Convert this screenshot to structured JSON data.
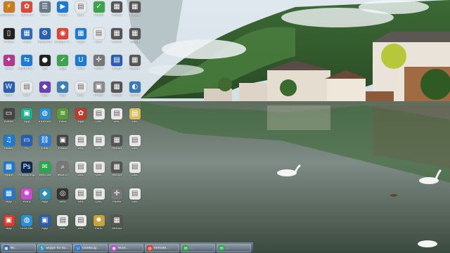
{
  "desktop_icons": [
    {
      "label": "Wondershare",
      "icon": "app-icon",
      "color": "#c97b1f",
      "glyph": "⚡"
    },
    {
      "label": "Tencent",
      "icon": "app-icon",
      "color": "#d94b37",
      "glyph": "✿"
    },
    {
      "label": "Wi-Fi",
      "icon": "app-icon",
      "color": "#6a7a8d",
      "glyph": "☰"
    },
    {
      "label": "Video",
      "icon": "play-icon",
      "color": "#1e7ad1",
      "glyph": "▶"
    },
    {
      "label": "Doc",
      "icon": "document-icon",
      "color": "#e8e8e8",
      "glyph": "▤"
    },
    {
      "label": "Cloud",
      "icon": "app-icon",
      "color": "#3fa34d",
      "glyph": "✓"
    },
    {
      "label": "Media",
      "icon": "app-icon",
      "color": "#555",
      "glyph": "▦"
    },
    {
      "label": "Media",
      "icon": "app-icon",
      "color": "#555",
      "glyph": "▦"
    },
    {
      "label": "Phone",
      "icon": "phone-icon",
      "color": "#222",
      "glyph": "▯"
    },
    {
      "label": "Tools",
      "icon": "app-icon",
      "color": "#2e6db4",
      "glyph": "▦"
    },
    {
      "label": "Network",
      "icon": "app-icon",
      "color": "#2a5fb0",
      "glyph": "⚙"
    },
    {
      "label": "Google Chrome",
      "icon": "chrome-icon",
      "color": "#db4437",
      "glyph": "◉"
    },
    {
      "label": "Apps",
      "icon": "app-icon",
      "color": "#1e7ad1",
      "glyph": "▦"
    },
    {
      "label": "Doc",
      "icon": "document-icon",
      "color": "#e8e8e8",
      "glyph": "▤"
    },
    {
      "label": "Media",
      "icon": "app-icon",
      "color": "#555",
      "glyph": "▦"
    },
    {
      "label": "Media",
      "icon": "app-icon",
      "color": "#555",
      "glyph": "▦"
    },
    {
      "label": "Tools",
      "icon": "app-icon",
      "color": "#b03a8c",
      "glyph": "✦"
    },
    {
      "label": "TeamViewer",
      "icon": "app-icon",
      "color": "#1e7ad1",
      "glyph": "⇆"
    },
    {
      "label": "QQ",
      "icon": "app-icon",
      "color": "#222",
      "glyph": "●"
    },
    {
      "label": "App",
      "icon": "app-icon",
      "color": "#3fa34d",
      "glyph": "✓"
    },
    {
      "label": "Link",
      "icon": "app-icon",
      "color": "#1e7ad1",
      "glyph": "U"
    },
    {
      "label": "Move",
      "icon": "app-icon",
      "color": "#777",
      "glyph": "✛"
    },
    {
      "label": "Sheet",
      "icon": "document-icon",
      "color": "#2a5fb0",
      "glyph": "▤"
    },
    {
      "label": "Media",
      "icon": "app-icon",
      "color": "#555",
      "glyph": "▦"
    },
    {
      "label": "Word",
      "icon": "word-icon",
      "color": "#2a5fb0",
      "glyph": "W"
    },
    {
      "label": "Doc",
      "icon": "document-icon",
      "color": "#e8e8e8",
      "glyph": "▤"
    },
    {
      "label": "App",
      "icon": "app-icon",
      "color": "#6a3fb0",
      "glyph": "◆"
    },
    {
      "label": "App",
      "icon": "app-icon",
      "color": "#3f7fb0",
      "glyph": "◆"
    },
    {
      "label": "Doc",
      "icon": "document-icon",
      "color": "#e8e8e8",
      "glyph": "▤"
    },
    {
      "label": "Photo",
      "icon": "photo-icon",
      "color": "#8a8a8a",
      "glyph": "▣"
    },
    {
      "label": "Media",
      "icon": "app-icon",
      "color": "#555",
      "glyph": "▦"
    },
    {
      "label": "Media",
      "icon": "app-icon",
      "color": "#3a7ab0",
      "glyph": "◐"
    },
    {
      "label": "Folder",
      "icon": "app-icon",
      "color": "#444",
      "glyph": "▭"
    },
    {
      "label": "App",
      "icon": "app-icon",
      "color": "#1fae8c",
      "glyph": "▣"
    },
    {
      "label": "Internet",
      "icon": "app-icon",
      "color": "#2a8fd1",
      "glyph": "◍"
    },
    {
      "label": "Feed",
      "icon": "app-icon",
      "color": "#5a9a3a",
      "glyph": "≋"
    },
    {
      "label": "App",
      "icon": "app-icon",
      "color": "#c0392b",
      "glyph": "✿"
    },
    {
      "label": "Doc",
      "icon": "document-icon",
      "color": "#e8e8e8",
      "glyph": "▤"
    },
    {
      "label": "Doc",
      "icon": "document-icon",
      "color": "#e8e8e8",
      "glyph": "▤"
    },
    {
      "label": "Doc",
      "icon": "document-icon",
      "color": "#d8c060",
      "glyph": "▤"
    },
    {
      "label": "Music",
      "icon": "app-icon",
      "color": "#1e7ad1",
      "glyph": "♫"
    },
    {
      "label": "PC",
      "icon": "app-icon",
      "color": "#2a5fb0",
      "glyph": "▭"
    },
    {
      "label": "Link",
      "icon": "app-icon",
      "color": "#2a7ad1",
      "glyph": "⛓"
    },
    {
      "label": "Photo",
      "icon": "photo-icon",
      "color": "#444",
      "glyph": "▣"
    },
    {
      "label": "Doc",
      "icon": "document-icon",
      "color": "#e8e8e8",
      "glyph": "▤"
    },
    {
      "label": "Doc",
      "icon": "document-icon",
      "color": "#e8e8e8",
      "glyph": "▤"
    },
    {
      "label": "Media",
      "icon": "app-icon",
      "color": "#555",
      "glyph": "▦"
    },
    {
      "label": "Doc",
      "icon": "document-icon",
      "color": "#e8e8e8",
      "glyph": "▤"
    },
    {
      "label": "Apps",
      "icon": "app-icon",
      "color": "#1e7ad1",
      "glyph": "▦"
    },
    {
      "label": "Photoshop",
      "icon": "app-icon",
      "color": "#0b2a52",
      "glyph": "Ps"
    },
    {
      "label": "WeChat",
      "icon": "app-icon",
      "color": "#2aa84a",
      "glyph": "✉"
    },
    {
      "label": "Search",
      "icon": "search-icon",
      "color": "#777",
      "glyph": "⌕"
    },
    {
      "label": "Doc",
      "icon": "document-icon",
      "color": "#e8e8e8",
      "glyph": "▤"
    },
    {
      "label": "Doc",
      "icon": "document-icon",
      "color": "#e8e8e8",
      "glyph": "▤"
    },
    {
      "label": "Media",
      "icon": "app-icon",
      "color": "#555",
      "glyph": "▦"
    },
    {
      "label": "Doc",
      "icon": "document-icon",
      "color": "#e8e8e8",
      "glyph": "▤"
    },
    {
      "label": "App",
      "icon": "app-icon",
      "color": "#1e7ad1",
      "glyph": "▦"
    },
    {
      "label": "Paint",
      "icon": "app-icon",
      "color": "#c94bd1",
      "glyph": "✺"
    },
    {
      "label": "App",
      "icon": "app-icon",
      "color": "#2e8fb0",
      "glyph": "◆"
    },
    {
      "label": "Disc",
      "icon": "app-icon",
      "color": "#333",
      "glyph": "◎"
    },
    {
      "label": "Doc",
      "icon": "document-icon",
      "color": "#e8e8e8",
      "glyph": "▤"
    },
    {
      "label": "Doc",
      "icon": "document-icon",
      "color": "#e8e8e8",
      "glyph": "▤"
    },
    {
      "label": "Move",
      "icon": "app-icon",
      "color": "#777",
      "glyph": "✛"
    },
    {
      "label": "Doc",
      "icon": "document-icon",
      "color": "#e8e8e8",
      "glyph": "▤"
    },
    {
      "label": "App",
      "icon": "app-icon",
      "color": "#d93c2c",
      "glyph": "▣"
    },
    {
      "label": "Internet",
      "icon": "app-icon",
      "color": "#2a8fd1",
      "glyph": "◍"
    },
    {
      "label": "App",
      "icon": "app-icon",
      "color": "#2a5fb0",
      "glyph": "▣"
    },
    {
      "label": "Doc",
      "icon": "document-icon",
      "color": "#e8e8e8",
      "glyph": "▤"
    },
    {
      "label": "Doc",
      "icon": "document-icon",
      "color": "#e8e8e8",
      "glyph": "▤"
    },
    {
      "label": "Paint",
      "icon": "app-icon",
      "color": "#c9a23a",
      "glyph": "✹"
    },
    {
      "label": "Media",
      "icon": "app-icon",
      "color": "#555",
      "glyph": "▦"
    }
  ],
  "taskbar_buttons": [
    {
      "label": "Wi...",
      "icon": "app-icon",
      "color": "#2a5fb0",
      "glyph": "▣"
    },
    {
      "label": "Skype for busi...",
      "icon": "skype-icon",
      "color": "#1e9ad1",
      "glyph": "S"
    },
    {
      "label": "Useebug...",
      "icon": "app-icon",
      "color": "#1e7ad1",
      "glyph": "U"
    },
    {
      "label": "Wise...",
      "icon": "app-icon",
      "color": "#c94bd1",
      "glyph": "◉"
    },
    {
      "label": "Remote...",
      "icon": "app-icon",
      "color": "#d93c2c",
      "glyph": "◍"
    },
    {
      "label": "...",
      "icon": "app-icon",
      "color": "#2aa84a",
      "glyph": "✉"
    },
    {
      "label": "...",
      "icon": "app-icon",
      "color": "#2aa84a",
      "glyph": "✉"
    }
  ]
}
